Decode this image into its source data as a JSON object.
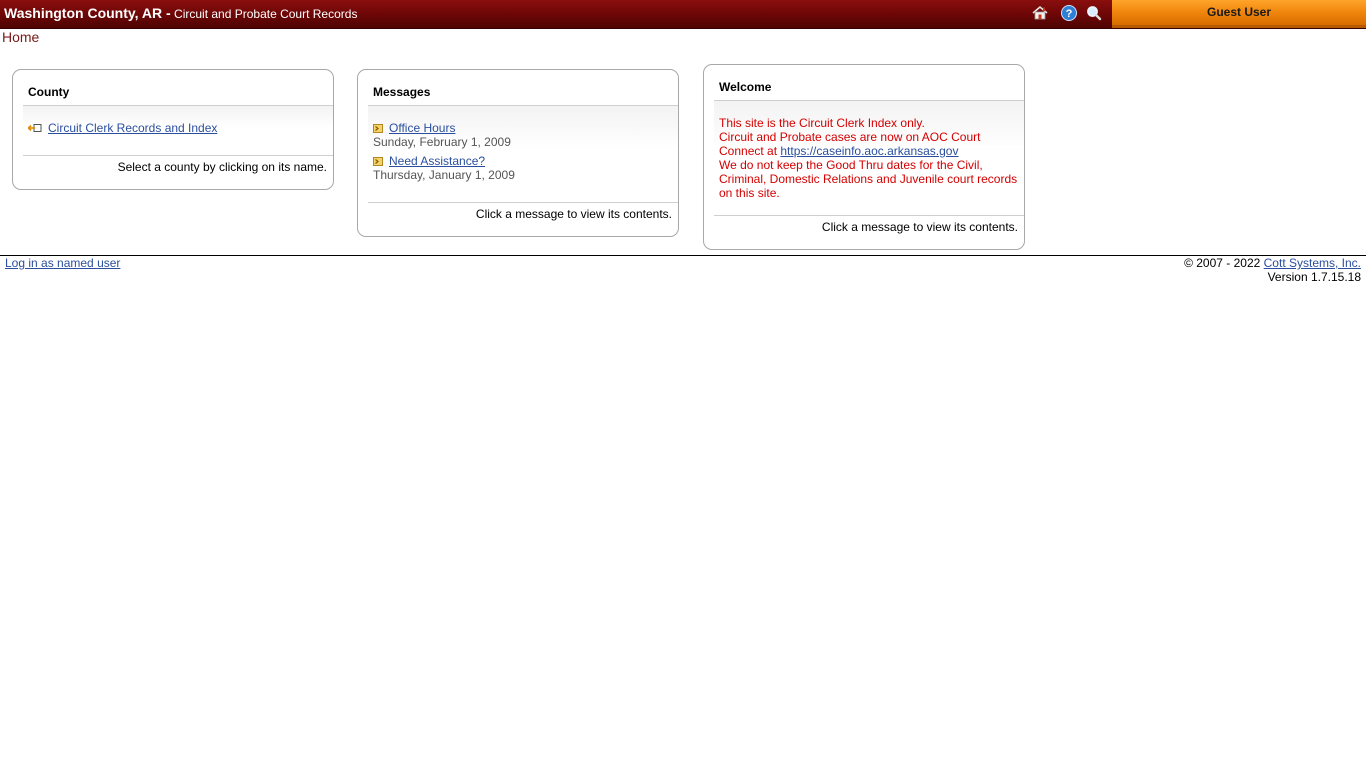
{
  "header": {
    "county": "Washington County, AR -",
    "subtitle": "Circuit and Probate Court Records",
    "icons": [
      "home-icon",
      "help-icon",
      "search-icon"
    ],
    "user": "Guest User",
    "colors": {
      "bar": "#6b0606",
      "user_box": "#f0850c"
    }
  },
  "breadcrumb": "Home",
  "county_panel": {
    "title": "County",
    "items": [
      {
        "label": "Circuit Clerk Records and Index"
      }
    ],
    "footer": "Select a county by clicking on its name."
  },
  "messages_panel": {
    "title": "Messages",
    "items": [
      {
        "label": "Office Hours",
        "date": "Sunday, February 1, 2009"
      },
      {
        "label": "Need Assistance?",
        "date": "Thursday, January 1, 2009"
      }
    ],
    "footer": "Click a message to view its contents."
  },
  "welcome_panel": {
    "title": "Welcome",
    "line1": "This site is the Circuit Clerk Index only.",
    "line2": "Circuit and Probate cases are now on AOC Court",
    "line3_prefix": "Connect at ",
    "link": "https://caseinfo.aoc.arkansas.gov",
    "line4": "We do not keep the Good Thru dates for the Civil, Criminal, Domestic Relations and Juvenile court records on this site.",
    "footer": "Click a message to view its contents.",
    "text_color": "#d40000"
  },
  "footer": {
    "login": "Log in as named user",
    "copyright_prefix": "© 2007 - 2022 ",
    "company": "Cott Systems, Inc.",
    "version": "Version 1.7.15.18"
  }
}
